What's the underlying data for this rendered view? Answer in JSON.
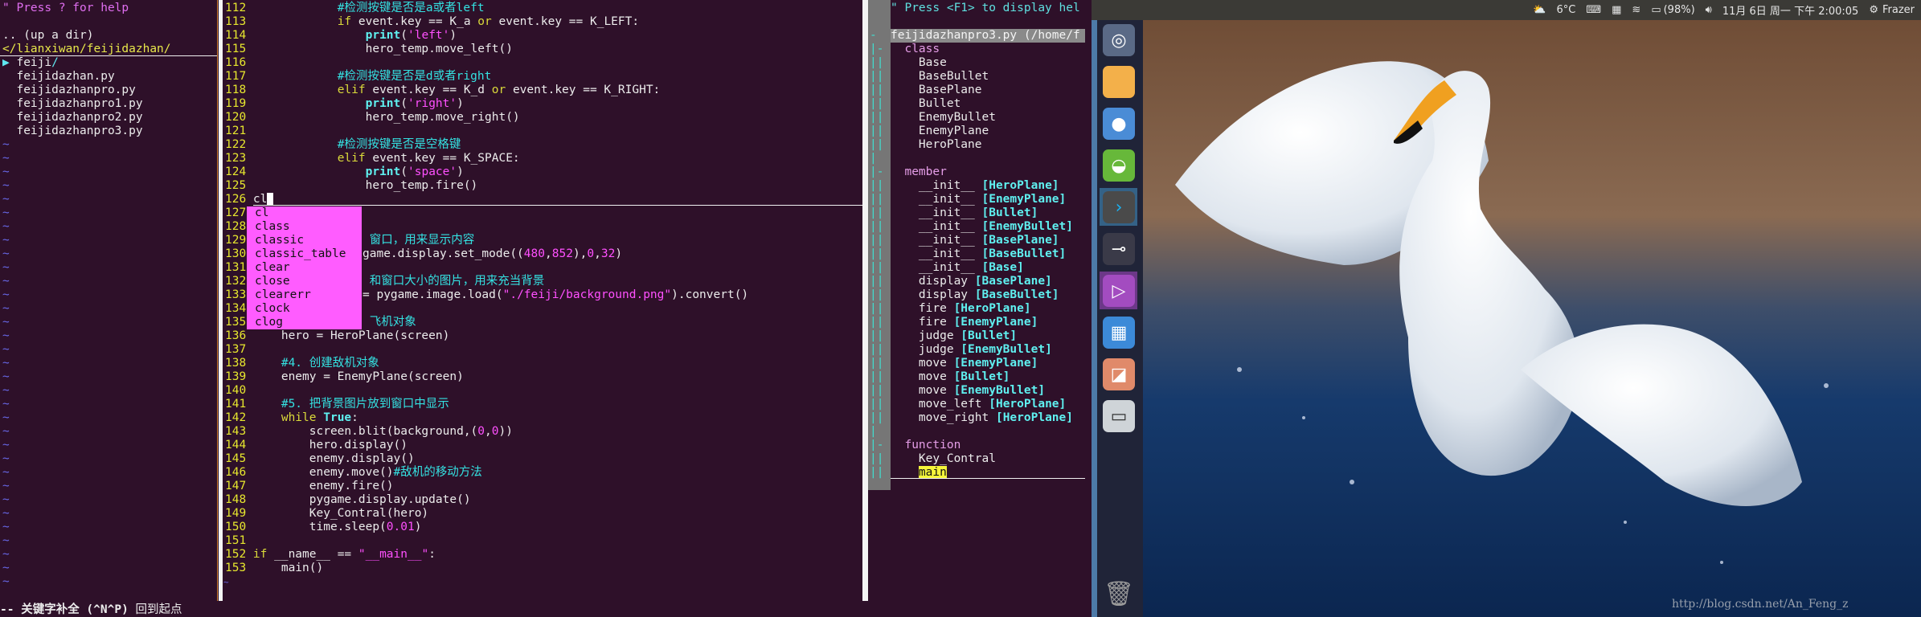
{
  "nerdtree": {
    "help": "\" Press ? for help",
    "updir": ".. (up a dir)",
    "path": "</lianxiwan/feijidazhan/",
    "folder_arrow": "▶",
    "folder": "feiji",
    "folder_slash": "/",
    "files": [
      "feijidazhan.py",
      "feijidazhanpro.py",
      "feijidazhanpro1.py",
      "feijidazhanpro2.py",
      "feijidazhanpro3.py"
    ],
    "tilde": "~"
  },
  "editor": {
    "lines": [
      {
        "n": "112",
        "t": [
          [
            "n",
            "            "
          ],
          [
            "c",
            "#检测按键是否是a或者left"
          ]
        ]
      },
      {
        "n": "113",
        "t": [
          [
            "n",
            "            "
          ],
          [
            "k",
            "if"
          ],
          [
            "n",
            " event.key == K_a "
          ],
          [
            "k",
            "or"
          ],
          [
            "n",
            " event.key == K_LEFT:"
          ]
        ]
      },
      {
        "n": "114",
        "t": [
          [
            "n",
            "                "
          ],
          [
            "b",
            "print"
          ],
          [
            "n",
            "("
          ],
          [
            "s",
            "'left'"
          ],
          [
            "n",
            ")"
          ]
        ]
      },
      {
        "n": "115",
        "t": [
          [
            "n",
            "                hero_temp.move_left()"
          ]
        ]
      },
      {
        "n": "116",
        "t": []
      },
      {
        "n": "117",
        "t": [
          [
            "n",
            "            "
          ],
          [
            "c",
            "#检测按键是否是d或者right"
          ]
        ]
      },
      {
        "n": "118",
        "t": [
          [
            "n",
            "            "
          ],
          [
            "k",
            "elif"
          ],
          [
            "n",
            " event.key == K_d "
          ],
          [
            "k",
            "or"
          ],
          [
            "n",
            " event.key == K_RIGHT:"
          ]
        ]
      },
      {
        "n": "119",
        "t": [
          [
            "n",
            "                "
          ],
          [
            "b",
            "print"
          ],
          [
            "n",
            "("
          ],
          [
            "s",
            "'right'"
          ],
          [
            "n",
            ")"
          ]
        ]
      },
      {
        "n": "120",
        "t": [
          [
            "n",
            "                hero_temp.move_right()"
          ]
        ]
      },
      {
        "n": "121",
        "t": []
      },
      {
        "n": "122",
        "t": [
          [
            "n",
            "            "
          ],
          [
            "c",
            "#检测按键是否是空格键"
          ]
        ]
      },
      {
        "n": "123",
        "t": [
          [
            "n",
            "            "
          ],
          [
            "k",
            "elif"
          ],
          [
            "n",
            " event.key == K_SPACE:"
          ]
        ]
      },
      {
        "n": "124",
        "t": [
          [
            "n",
            "                "
          ],
          [
            "b",
            "print"
          ],
          [
            "n",
            "("
          ],
          [
            "s",
            "'space'"
          ],
          [
            "n",
            ")"
          ]
        ]
      },
      {
        "n": "125",
        "t": [
          [
            "n",
            "                hero_temp.fire()"
          ]
        ]
      },
      {
        "n": "126",
        "t": [
          [
            "n",
            "cl"
          ]
        ],
        "cursor": true
      },
      {
        "n": "127",
        "t": [],
        "clip": true
      },
      {
        "n": "128",
        "t": [],
        "clip": true
      },
      {
        "n": "129",
        "t": [
          [
            "c",
            " 窗口，用来显示内容"
          ]
        ],
        "clip": true
      },
      {
        "n": "130",
        "t": [
          [
            "n",
            "game.display.set_mode(("
          ],
          [
            "d",
            "480"
          ],
          [
            "n",
            ","
          ],
          [
            "d",
            "852"
          ],
          [
            "n",
            "),"
          ],
          [
            "d",
            "0"
          ],
          [
            "n",
            ","
          ],
          [
            "d",
            "32"
          ],
          [
            "n",
            ")"
          ]
        ],
        "clip": true
      },
      {
        "n": "131",
        "t": [],
        "clip": true
      },
      {
        "n": "132",
        "t": [
          [
            "c",
            " 和窗口大小的图片，用来充当背景"
          ]
        ],
        "clip": true
      },
      {
        "n": "133",
        "t": [
          [
            "n",
            "= pygame.image.load("
          ],
          [
            "s",
            "\"./feiji/background.png\""
          ],
          [
            "n",
            ").convert()"
          ]
        ],
        "clip": true
      },
      {
        "n": "134",
        "t": [],
        "clip": true
      },
      {
        "n": "135",
        "t": [
          [
            "c",
            " 飞机对象"
          ]
        ],
        "clip": true
      },
      {
        "n": "136",
        "t": [
          [
            "n",
            "    hero = HeroPlane(screen)"
          ]
        ]
      },
      {
        "n": "137",
        "t": []
      },
      {
        "n": "138",
        "t": [
          [
            "n",
            "    "
          ],
          [
            "c",
            "#4. 创建敌机对象"
          ]
        ]
      },
      {
        "n": "139",
        "t": [
          [
            "n",
            "    enemy = EnemyPlane(screen)"
          ]
        ]
      },
      {
        "n": "140",
        "t": []
      },
      {
        "n": "141",
        "t": [
          [
            "n",
            "    "
          ],
          [
            "c",
            "#5. 把背景图片放到窗口中显示"
          ]
        ]
      },
      {
        "n": "142",
        "t": [
          [
            "n",
            "    "
          ],
          [
            "k",
            "while"
          ],
          [
            "n",
            " "
          ],
          [
            "b",
            "True"
          ],
          [
            "n",
            ":"
          ]
        ]
      },
      {
        "n": "143",
        "t": [
          [
            "n",
            "        screen.blit(background,("
          ],
          [
            "d",
            "0"
          ],
          [
            "n",
            ","
          ],
          [
            "d",
            "0"
          ],
          [
            "n",
            "))"
          ]
        ]
      },
      {
        "n": "144",
        "t": [
          [
            "n",
            "        hero.display()"
          ]
        ]
      },
      {
        "n": "145",
        "t": [
          [
            "n",
            "        enemy.display()"
          ]
        ]
      },
      {
        "n": "146",
        "t": [
          [
            "n",
            "        enemy.move()"
          ],
          [
            "c",
            "#敌机的移动方法"
          ]
        ]
      },
      {
        "n": "147",
        "t": [
          [
            "n",
            "        enemy.fire()"
          ]
        ]
      },
      {
        "n": "148",
        "t": [
          [
            "n",
            "        pygame.display.update()"
          ]
        ]
      },
      {
        "n": "149",
        "t": [
          [
            "n",
            "        Key_Contral(hero)"
          ]
        ]
      },
      {
        "n": "150",
        "t": [
          [
            "n",
            "        time.sleep("
          ],
          [
            "d",
            "0.01"
          ],
          [
            "n",
            ")"
          ]
        ]
      },
      {
        "n": "151",
        "t": []
      },
      {
        "n": "152",
        "t": [
          [
            "k",
            "if"
          ],
          [
            "n",
            " __name__ == "
          ],
          [
            "s",
            "\"__main__\""
          ],
          [
            "n",
            ":"
          ]
        ]
      },
      {
        "n": "153",
        "t": [
          [
            "n",
            "    main()"
          ]
        ]
      }
    ],
    "tilde": "~",
    "completion_menu": [
      "cl",
      "class",
      "classic",
      "classic_table",
      "clear",
      "close",
      "clearerr",
      "clock",
      "clog"
    ]
  },
  "tagbar": {
    "help": "\" Press <F1> to display hel",
    "file": "feijidazhanpro3.py (/home/f",
    "groups": [
      {
        "label": "class",
        "items": [
          {
            "name": "Base"
          },
          {
            "name": "BaseBullet"
          },
          {
            "name": "BasePlane"
          },
          {
            "name": "Bullet"
          },
          {
            "name": "EnemyBullet"
          },
          {
            "name": "EnemyPlane"
          },
          {
            "name": "HeroPlane"
          }
        ]
      },
      {
        "label": "member",
        "items": [
          {
            "name": "__init__",
            "scope": "[HeroPlane]"
          },
          {
            "name": "__init__",
            "scope": "[EnemyPlane]"
          },
          {
            "name": "__init__",
            "scope": "[Bullet]"
          },
          {
            "name": "__init__",
            "scope": "[EnemyBullet]"
          },
          {
            "name": "__init__",
            "scope": "[BasePlane]"
          },
          {
            "name": "__init__",
            "scope": "[BaseBullet]"
          },
          {
            "name": "__init__",
            "scope": "[Base]"
          },
          {
            "name": "display",
            "scope": "[BasePlane]"
          },
          {
            "name": "display",
            "scope": "[BaseBullet]"
          },
          {
            "name": "fire",
            "scope": "[HeroPlane]"
          },
          {
            "name": "fire",
            "scope": "[EnemyPlane]"
          },
          {
            "name": "judge",
            "scope": "[Bullet]"
          },
          {
            "name": "judge",
            "scope": "[EnemyBullet]"
          },
          {
            "name": "move",
            "scope": "[EnemyPlane]"
          },
          {
            "name": "move",
            "scope": "[Bullet]"
          },
          {
            "name": "move",
            "scope": "[EnemyBullet]"
          },
          {
            "name": "move_left",
            "scope": "[HeroPlane]"
          },
          {
            "name": "move_right",
            "scope": "[HeroPlane]"
          }
        ]
      },
      {
        "label": "function",
        "items": [
          {
            "name": "Key_Contral"
          },
          {
            "name": "main",
            "selected": true
          }
        ]
      }
    ]
  },
  "statusline": {
    "mode": "-- 关键字补全 ",
    "keys": "(^N^P) ",
    "message": "回到起点"
  },
  "top_panel": {
    "temperature": "6°C",
    "battery": "(98%)",
    "datetime": "11月 6日 周一 下午 2:00:05",
    "user": "Frazer"
  },
  "dock": {
    "items": [
      {
        "name": "ubuntu-dash",
        "glyph": "◎",
        "color": "#5a6a86"
      },
      {
        "name": "files",
        "glyph": "",
        "color": "#f3b04a"
      },
      {
        "name": "chromium",
        "glyph": "●",
        "color": "#4a8cd6"
      },
      {
        "name": "software-center",
        "glyph": "◒",
        "color": "#67b83a"
      },
      {
        "name": "terminal",
        "glyph": "›",
        "color": "#4a4a4a",
        "selected": true
      },
      {
        "name": "screen-recorder",
        "glyph": "⊸",
        "color": "#3a3a48"
      },
      {
        "name": "video-player",
        "glyph": "▷",
        "color": "#a34cc0",
        "selected": true
      },
      {
        "name": "workspace-switcher",
        "glyph": "▦",
        "color": "#3c8ad8"
      },
      {
        "name": "presentation",
        "glyph": "◪",
        "color": "#e08a6a"
      },
      {
        "name": "hdd",
        "glyph": "▭",
        "color": "#cfd4d8"
      }
    ],
    "trash": "trash"
  },
  "watermark": "http://blog.csdn.net/An_Feng_z"
}
